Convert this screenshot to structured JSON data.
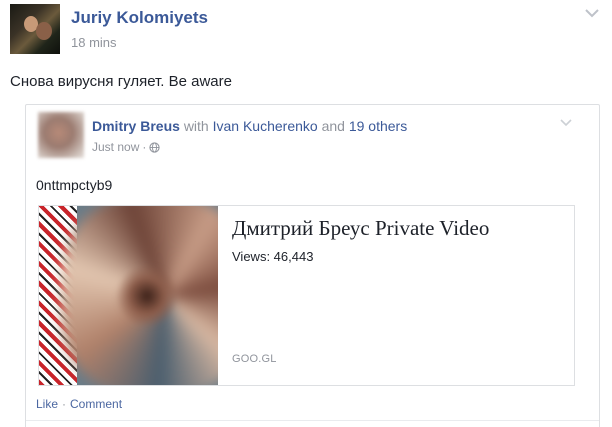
{
  "post": {
    "author": "Juriy Kolomiyets",
    "time": "18 mins",
    "text": "Снова вирусня гуляет. Be aware"
  },
  "shared": {
    "author": "Dmitry Breus",
    "with_word": "with",
    "tagged": "Ivan Kucherenko",
    "and_word": "and",
    "others": "19 others",
    "time": "Just now",
    "separator": "·",
    "text": "0nttmpctyb9",
    "link": {
      "title": "Дмитрий Бреус Private Video",
      "views": "Views: 46,443",
      "domain": "GOO.GL"
    },
    "actions": {
      "like": "Like",
      "separator": "·",
      "comment": "Comment"
    }
  },
  "colors": {
    "link_blue": "#3b5998",
    "muted": "#90949c",
    "border": "#dddfe2"
  },
  "icons": [
    "chevron-down-icon",
    "globe-icon"
  ]
}
